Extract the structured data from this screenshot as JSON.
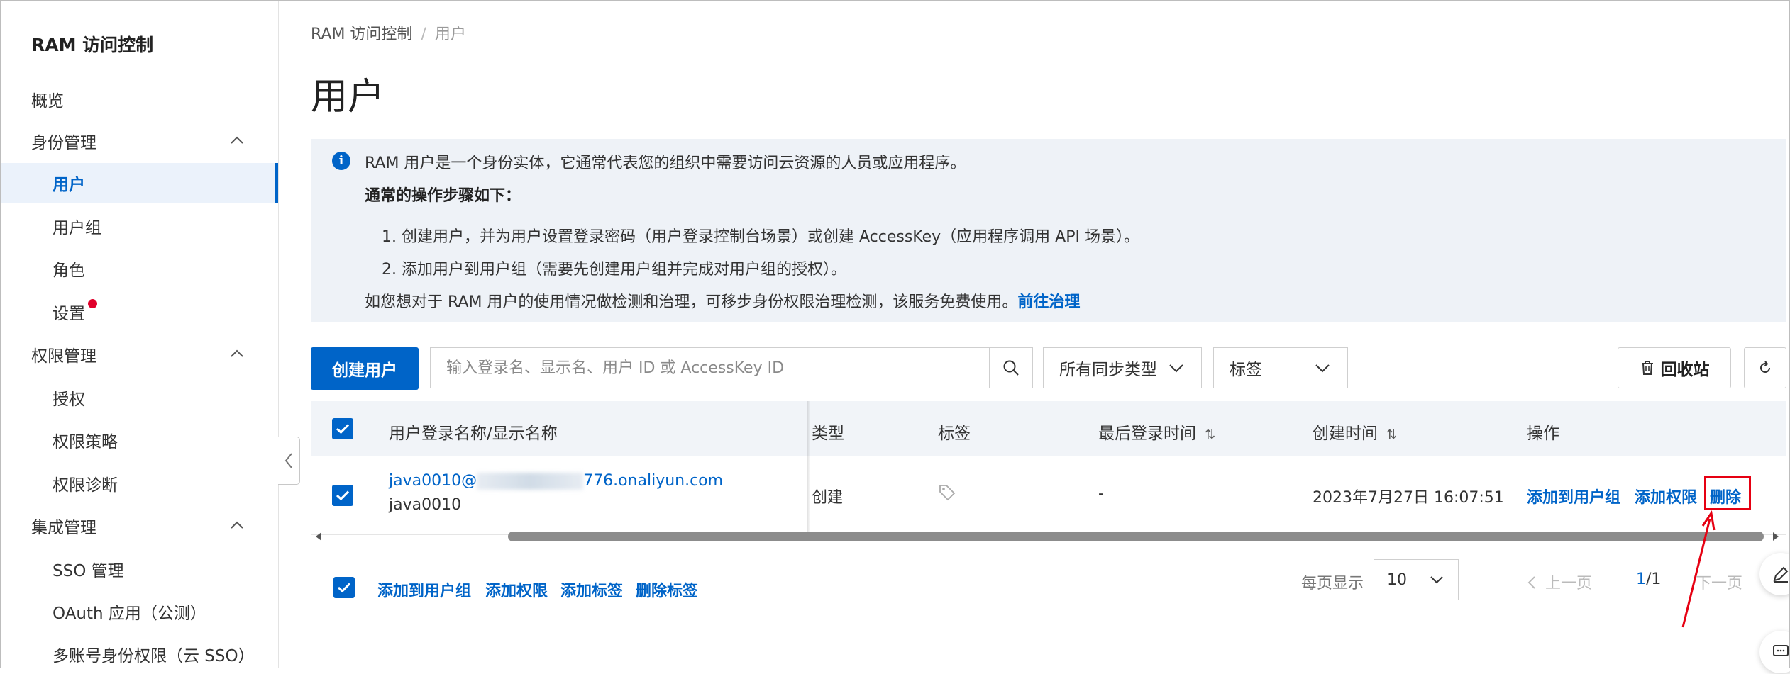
{
  "sidebar": {
    "title": "RAM 访问控制",
    "items": [
      {
        "label": "概览"
      },
      {
        "label": "身份管理"
      },
      {
        "label": "用户"
      },
      {
        "label": "用户组"
      },
      {
        "label": "角色"
      },
      {
        "label": "设置"
      },
      {
        "label": "权限管理"
      },
      {
        "label": "授权"
      },
      {
        "label": "权限策略"
      },
      {
        "label": "权限诊断"
      },
      {
        "label": "集成管理"
      },
      {
        "label": "SSO 管理"
      },
      {
        "label": "OAuth 应用（公测）"
      },
      {
        "label": "多账号身份权限（云 SSO）"
      }
    ]
  },
  "breadcrumb": {
    "root": "RAM 访问控制",
    "sep": "/",
    "current": "用户"
  },
  "page_title": "用户",
  "info": {
    "line1": "RAM 用户是一个身份实体，它通常代表您的组织中需要访问云资源的人员或应用程序。",
    "line2": "通常的操作步骤如下：",
    "step1": "1. 创建用户，并为用户设置登录密码（用户登录控制台场景）或创建 AccessKey（应用程序调用 API 场景）。",
    "step2": "2. 添加用户到用户组（需要先创建用户组并完成对用户组的授权）。",
    "line3": "如您想对于 RAM 用户的使用情况做检测和治理，可移步身份权限治理检测，该服务免费使用。",
    "link": "前往治理"
  },
  "toolbar": {
    "create_label": "创建用户",
    "search_placeholder": "输入登录名、显示名、用户 ID 或 AccessKey ID",
    "sync_select": "所有同步类型",
    "tag_select": "标签",
    "recycle_label": "回收站"
  },
  "table": {
    "headers": {
      "name": "用户登录名称/显示名称",
      "type": "类型",
      "tag": "标签",
      "last_login": "最后登录时间",
      "created": "创建时间",
      "ops": "操作"
    },
    "rows": [
      {
        "login_prefix": "java0010@",
        "login_suffix": "776.onaliyun.com",
        "display": "java0010",
        "type": "创建",
        "last_login": "-",
        "created": "2023年7月27日 16:07:51",
        "op_add_group": "添加到用户组",
        "op_add_perm": "添加权限",
        "op_delete": "删除"
      }
    ]
  },
  "footer": {
    "add_group": "添加到用户组",
    "add_perm": "添加权限",
    "add_tag": "添加标签",
    "del_tag": "删除标签",
    "per_page_label": "每页显示",
    "per_page_value": "10",
    "prev": "上一页",
    "page_current": "1",
    "page_total": "/1",
    "next": "下一页"
  },
  "colors": {
    "accent": "#0064c8",
    "highlight": "#e60012",
    "info_bg": "#eef2f7"
  }
}
